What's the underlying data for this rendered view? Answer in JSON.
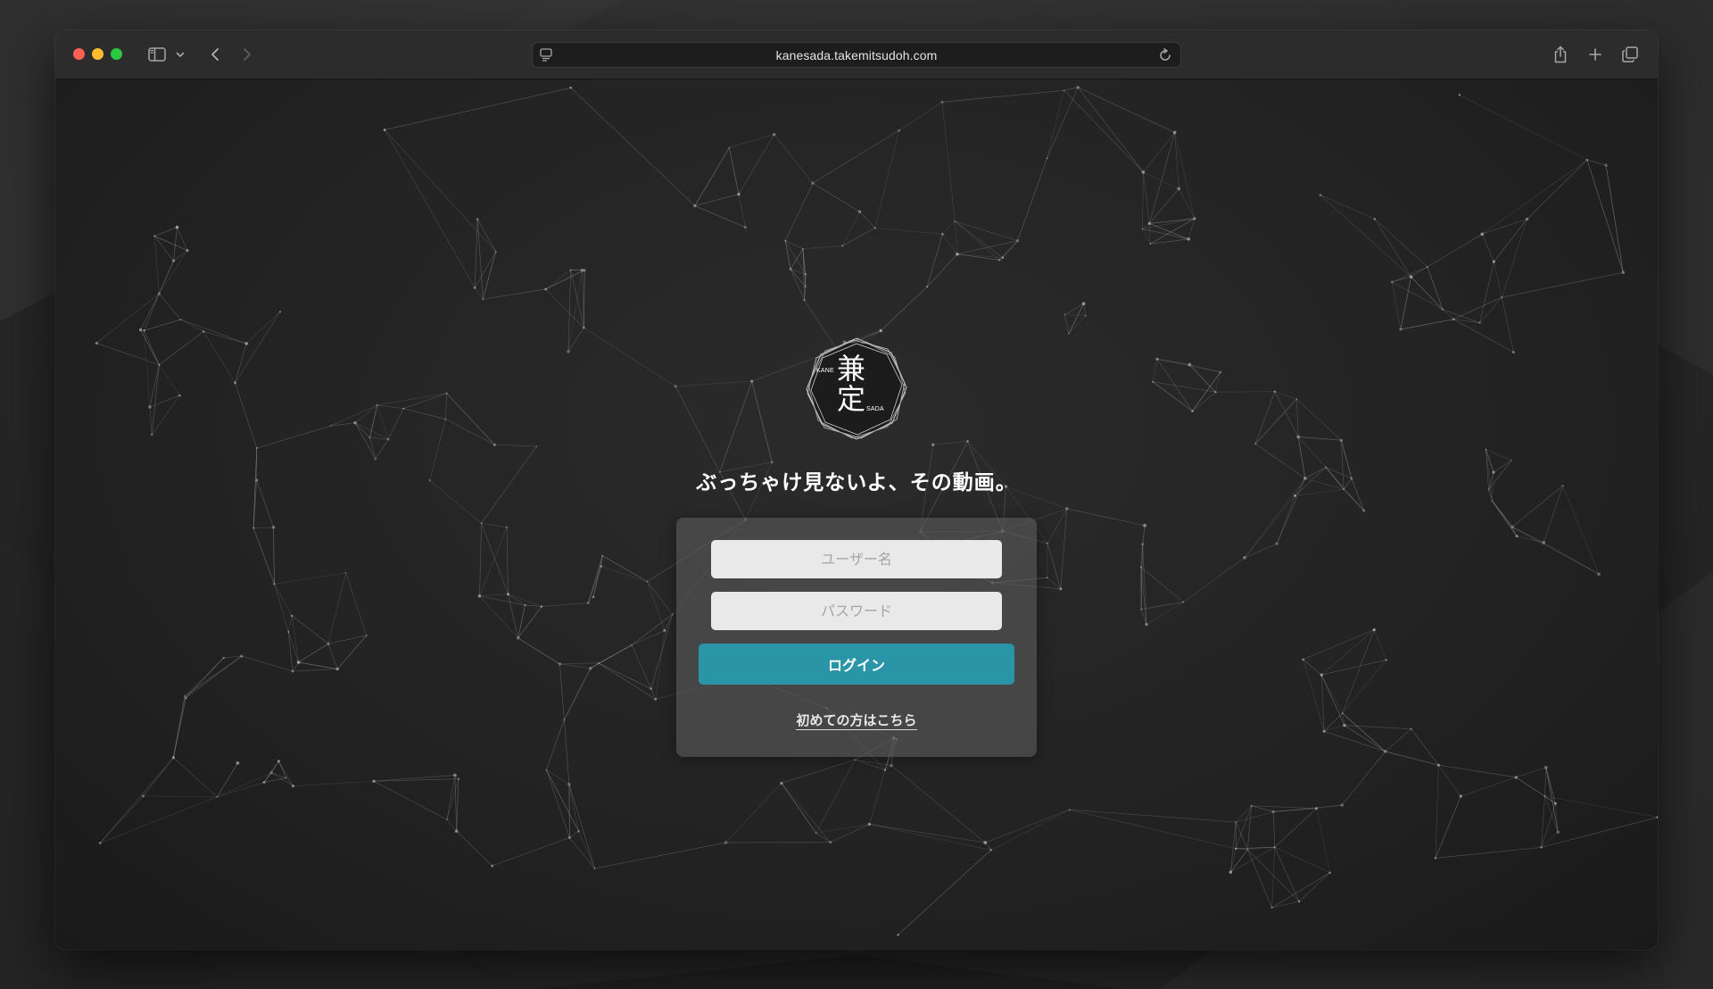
{
  "browser": {
    "url": "kanesada.takemitsudoh.com",
    "icons": {
      "close": "close-button",
      "minimize": "minimize-button",
      "zoom": "zoom-button",
      "sidebar": "sidebar-icon",
      "sidebar_menu": "chevron-down-icon",
      "back": "chevron-left-icon",
      "forward": "chevron-right-icon",
      "page_menu": "page-menu-icon",
      "reload": "reload-icon",
      "share": "share-icon",
      "new_tab": "plus-icon",
      "tab_overview": "tabs-overview-icon"
    }
  },
  "logo": {
    "kanji_top": "兼",
    "kanji_bottom": "定",
    "romaji_top": "KANE",
    "romaji_bottom": "SADA"
  },
  "tagline": "ぶっちゃけ見ないよ、その動画。",
  "login": {
    "username_placeholder": "ユーザー名",
    "password_placeholder": "パスワード",
    "button_label": "ログイン",
    "first_time_link": "初めての方はこちら"
  },
  "colors": {
    "accent": "#2b95a8",
    "panel": "#5a5a5a",
    "background": "#232323",
    "traffic_red": "#fe5f57",
    "traffic_yellow": "#febc2e",
    "traffic_green": "#28c840"
  }
}
